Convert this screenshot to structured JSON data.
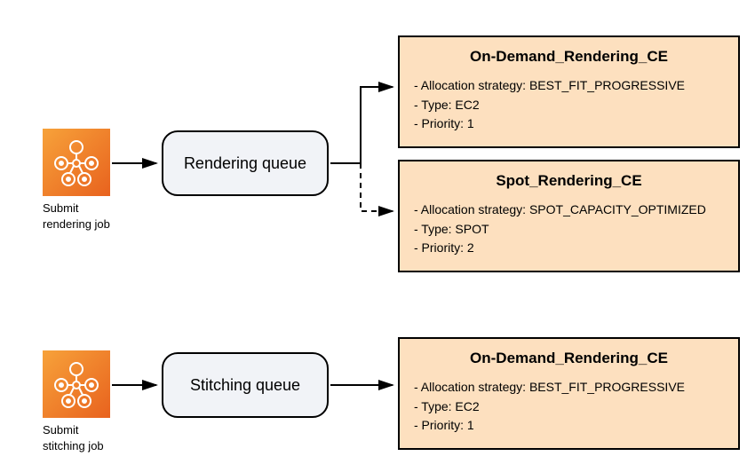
{
  "jobs": {
    "rendering": {
      "caption": "Submit\nrendering job"
    },
    "stitching": {
      "caption": "Submit\nstitching job"
    }
  },
  "queues": {
    "rendering": {
      "label": "Rendering queue"
    },
    "stitching": {
      "label": "Stitching queue"
    }
  },
  "compute_envs": {
    "ondemand_render": {
      "title": "On-Demand_Rendering_CE",
      "allocation_line": "- Allocation strategy: BEST_FIT_PROGRESSIVE",
      "type_line": "- Type: EC2",
      "priority_line": "- Priority: 1"
    },
    "spot_render": {
      "title": "Spot_Rendering_CE",
      "allocation_line": "- Allocation strategy: SPOT_CAPACITY_OPTIMIZED",
      "type_line": "- Type: SPOT",
      "priority_line": "- Priority: 2"
    },
    "ondemand_stitch": {
      "title": "On-Demand_Rendering_CE",
      "allocation_line": "- Allocation strategy: BEST_FIT_PROGRESSIVE",
      "type_line": "- Type: EC2",
      "priority_line": "- Priority: 1"
    }
  }
}
